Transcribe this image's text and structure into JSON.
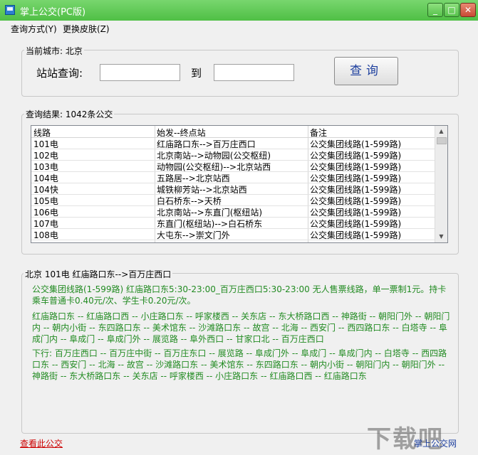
{
  "window": {
    "title": "掌上公交(PC版)",
    "minimize": "_",
    "maximize": "□",
    "close": "✕"
  },
  "menu": {
    "items": [
      "查询方式(Y)",
      "更换皮肤(Z)"
    ]
  },
  "search": {
    "current_city_label": "当前城市: 北京",
    "station_label": "站站查询:",
    "to_label": "到",
    "from_value": "",
    "to_value": "",
    "query_button": "查询"
  },
  "results": {
    "label": "查询结果: 1042条公交",
    "columns": [
      "线路",
      "始发--终点站",
      "备注"
    ],
    "rows": [
      [
        "101电",
        "红庙路口东-->百万庄西口",
        "公交集团线路(1-599路)"
      ],
      [
        "102电",
        "北京南站-->动物园(公交枢纽)",
        "公交集团线路(1-599路)"
      ],
      [
        "103电",
        "动物园(公交枢纽)-->北京站西",
        "公交集团线路(1-599路)"
      ],
      [
        "104电",
        "五路居-->北京站西",
        "公交集团线路(1-599路)"
      ],
      [
        "104快",
        "城铁柳芳站-->北京站西",
        "公交集团线路(1-599路)"
      ],
      [
        "105电",
        "白石桥东-->天桥",
        "公交集团线路(1-599路)"
      ],
      [
        "106电",
        "北京南站-->东直门(枢纽站)",
        "公交集团线路(1-599路)"
      ],
      [
        "107电",
        "东直门(枢纽站)-->白石桥东",
        "公交集团线路(1-599路)"
      ],
      [
        "108电",
        "大屯东-->崇文门外",
        "公交集团线路(1-599路)"
      ]
    ]
  },
  "detail": {
    "header": "北京 101电      红庙路口东-->百万庄西口",
    "para1": "公交集团线路(1-599路)      红庙路口东5:30-23:00_百万庄西口5:30-23:00      无人售票线路，单一票制1元。持卡乘车普通卡0.40元/次、学生卡0.20元/次。",
    "para2": "红庙路口东 -- 红庙路口西 -- 小庄路口东 -- 呼家楼西 -- 关东店 -- 东大桥路口西 -- 神路街 -- 朝阳门外 -- 朝阳门内 -- 朝内小街 -- 东四路口东 -- 美术馆东 -- 沙滩路口东 -- 故宫 -- 北海 -- 西安门 -- 西四路口东 -- 白塔寺 -- 阜成门内 -- 阜成门 -- 阜成门外 -- 展览路 -- 阜外西口 -- 甘家口北 -- 百万庄西口",
    "para3": "下行:      百万庄西口 -- 百万庄中街 -- 百万庄东口 -- 展览路 -- 阜成门外 -- 阜成门 -- 阜成门内 -- 白塔寺 -- 西四路口东 -- 西安门 -- 北海 -- 故宫 -- 沙滩路口东 -- 美术馆东 -- 东四路口东 -- 朝内小街 -- 朝阳门内 -- 朝阳门外 -- 神路街 -- 东大桥路口东 -- 关东店 -- 呼家楼西 -- 小庄路口东 -- 红庙路口西 -- 红庙路口东"
  },
  "footer": {
    "view_link": "查看此公交",
    "site": "掌上公交网"
  },
  "watermark": "下载吧"
}
